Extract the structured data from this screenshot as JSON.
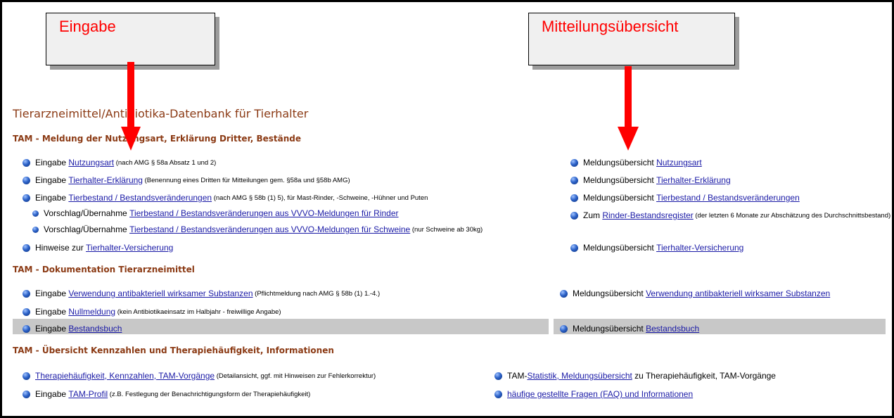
{
  "annotations": {
    "left_label": "Eingabe",
    "right_label": "Mitteilungsübersicht",
    "arrow_color": "#ff0000"
  },
  "page_title": "Tierarzneimittel/Antibiotika-Datenbank für Tierhalter",
  "sections": {
    "meldung": {
      "heading": "TAM - Meldung der Nutzungsart, Erklärung Dritter, Bestände",
      "left": [
        {
          "prefix": "Eingabe ",
          "link": "Nutzungsart",
          "note": " (nach AMG § 58a Absatz 1 und 2)"
        },
        {
          "prefix": "Eingabe ",
          "link": "Tierhalter-Erklärung",
          "note": " (Benennung eines Dritten für Mitteilungen gem. §58a und §58b AMG)"
        },
        {
          "prefix": "Eingabe ",
          "link": "Tierbestand / Bestandsveränderungen",
          "note": " (nach AMG § 58b (1) 5), für Mast-Rinder, -Schweine, -Hühner und Puten"
        },
        {
          "prefix": "Vorschlag/Übernahme ",
          "link": "Tierbestand / Bestandsveränderungen aus VVVO-Meldungen für Rinder",
          "note": ""
        },
        {
          "prefix": "Vorschlag/Übernahme ",
          "link": "Tierbestand / Bestandsveränderungen aus VVVO-Meldungen für Schweine",
          "note": " (nur Schweine ab 30kg)"
        },
        {
          "prefix": "Hinweise zur ",
          "link": "Tierhalter-Versicherung",
          "note": ""
        }
      ],
      "right": [
        {
          "prefix": "Meldungsübersicht ",
          "link": "Nutzungsart",
          "note": ""
        },
        {
          "prefix": "Meldungsübersicht ",
          "link": "Tierhalter-Erklärung",
          "note": ""
        },
        {
          "prefix": "Meldungsübersicht ",
          "link": "Tierbestand / Bestandsveränderungen",
          "note": ""
        },
        {
          "prefix": "Zum ",
          "link": "Rinder-Bestandsregister",
          "note": " (der letzten 6 Monate zur Abschätzung des Durchschnittsbestand)"
        },
        {
          "prefix": "Meldungsübersicht ",
          "link": "Tierhalter-Versicherung",
          "note": ""
        }
      ]
    },
    "doku": {
      "heading": "TAM - Dokumentation Tierarzneimittel",
      "left": [
        {
          "prefix": "Eingabe ",
          "link": "Verwendung antibakteriell wirksamer Substanzen",
          "note": " (Pflichtmeldung nach AMG § 58b (1) 1.-4.)"
        },
        {
          "prefix": "Eingabe ",
          "link": "Nullmeldung",
          "note": " (kein Antibiotikaeinsatz im Halbjahr - freiwillige Angabe)"
        },
        {
          "prefix": "Eingabe ",
          "link": "Bestandsbuch",
          "note": ""
        }
      ],
      "right": [
        {
          "prefix": "Meldungsübersicht ",
          "link": "Verwendung antibakteriell wirksamer Substanzen",
          "note": ""
        },
        {
          "prefix": "Meldungsübersicht ",
          "link": "Bestandsbuch",
          "note": ""
        }
      ]
    },
    "uebersicht": {
      "heading": "TAM - Übersicht Kennzahlen und Therapiehäufigkeit, Informationen",
      "left": [
        {
          "prefix": "",
          "link": "Therapiehäufigkeit, Kennzahlen, TAM-Vorgänge",
          "note": " (Detailansicht, ggf. mit Hinweisen zur Fehlerkorrektur)"
        },
        {
          "prefix": "Eingabe ",
          "link": "TAM-Profil",
          "note": " (z.B. Festlegung der Benachrichtigungsform der Therapiehäufigkeit)"
        }
      ],
      "right": [
        {
          "prefix": "TAM-",
          "link": "Statistik, Meldungsübersicht",
          "note": " zu Therapiehäufigkeit, TAM-Vorgänge"
        },
        {
          "prefix": "",
          "link": "häufige gestellte Fragen (FAQ) und Informationen",
          "note": ""
        }
      ]
    }
  }
}
